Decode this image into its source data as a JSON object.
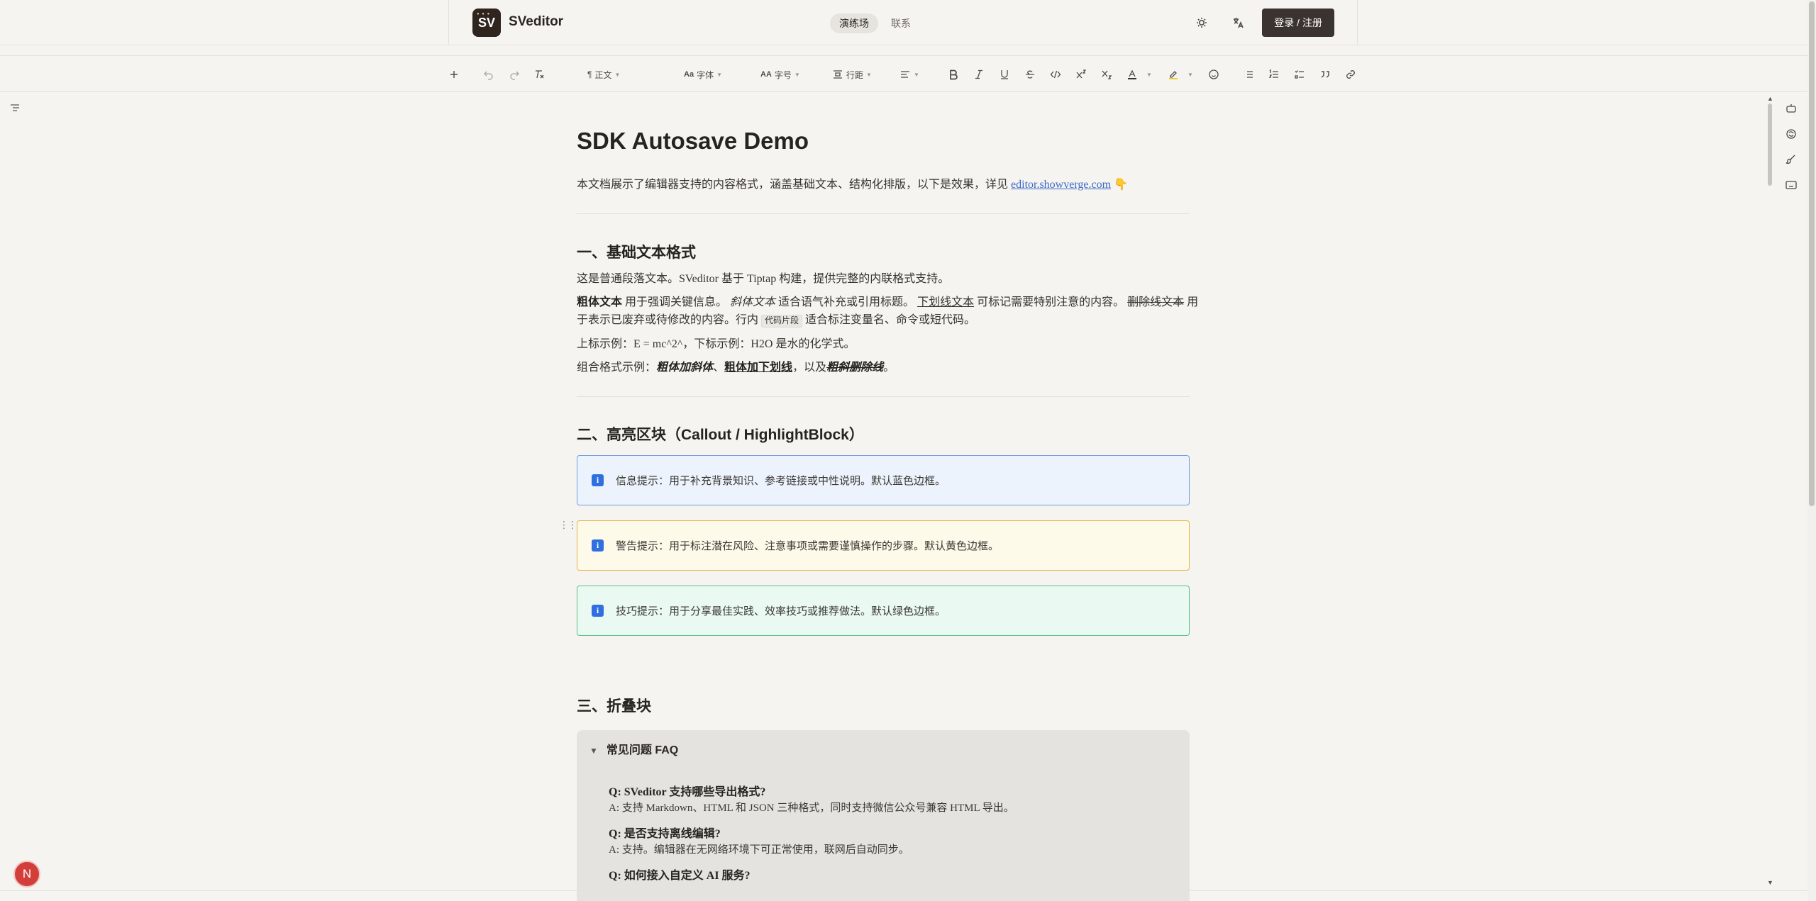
{
  "header": {
    "logo_text": "SV",
    "brand": "SVeditor",
    "nav": [
      {
        "label": "演练场",
        "active": true
      },
      {
        "label": "联系",
        "active": false
      }
    ],
    "icons": [
      "sun-icon",
      "translate-icon"
    ],
    "login_label": "登录 / 注册"
  },
  "toolbar": {
    "paragraph_label": "正文",
    "font_label": "字体",
    "font_size_label": "字号",
    "line_height_label": "行距"
  },
  "doc": {
    "title": "SDK Autosave Demo",
    "intro": "本文档展示了编辑器支持的内容格式，涵盖基础文本、结构化排版，以下是效果，详见",
    "intro_link": "editor.showverge.com",
    "intro_emoji": "👇",
    "section1": {
      "heading": "一、基础文本格式",
      "p1": "这是普通段落文本。SVeditor 基于 Tiptap 构建，提供完整的内联格式支持。",
      "bold_text": "粗体文本",
      "p2a": "用于强调关键信息。",
      "italic_text": "斜体文本",
      "p2b": "适合语气补充或引用标题。",
      "underline_text": "下划线文本",
      "p2c": "可标记需要特别注意的内容。",
      "strike_text": "删除线文本",
      "p2d": "用",
      "p2e": "于表示已废弃或待修改的内容。行内",
      "code_text": "代码片段",
      "p2f": "适合标注变量名、命令或短代码。",
      "p3": "上标示例：E = mc^2^，下标示例：H2O 是水的化学式。",
      "p4_prefix": "组合格式示例：",
      "combo1": "粗体加斜体",
      "combo2": "粗体加下划线",
      "p4_mid": "，以及",
      "combo3": "粗斜删除线",
      "p4_suffix": "。"
    },
    "section2": {
      "heading": "二、高亮区块（Callout / HighlightBlock）",
      "info": "信息提示：用于补充背景知识、参考链接或中性说明。默认蓝色边框。",
      "warn": "警告提示：用于标注潜在风险、注意事项或需要谨慎操作的步骤。默认黄色边框。",
      "tip": "技巧提示：用于分享最佳实践、效率技巧或推荐做法。默认绿色边框。"
    },
    "section3": {
      "heading": "三、折叠块",
      "fold_title": "常见问题 FAQ",
      "items": [
        {
          "q": "Q: SVeditor 支持哪些导出格式?",
          "a": "A: 支持 Markdown、HTML 和 JSON 三种格式，同时支持微信公众号兼容 HTML 导出。"
        },
        {
          "q": "Q: 是否支持离线编辑?",
          "a": "A: 支持。编辑器在无网络环境下可正常使用，联网后自动同步。"
        },
        {
          "q": "Q: 如何接入自定义 AI 服务?",
          "a": ""
        }
      ]
    }
  },
  "avatar_letter": "N"
}
